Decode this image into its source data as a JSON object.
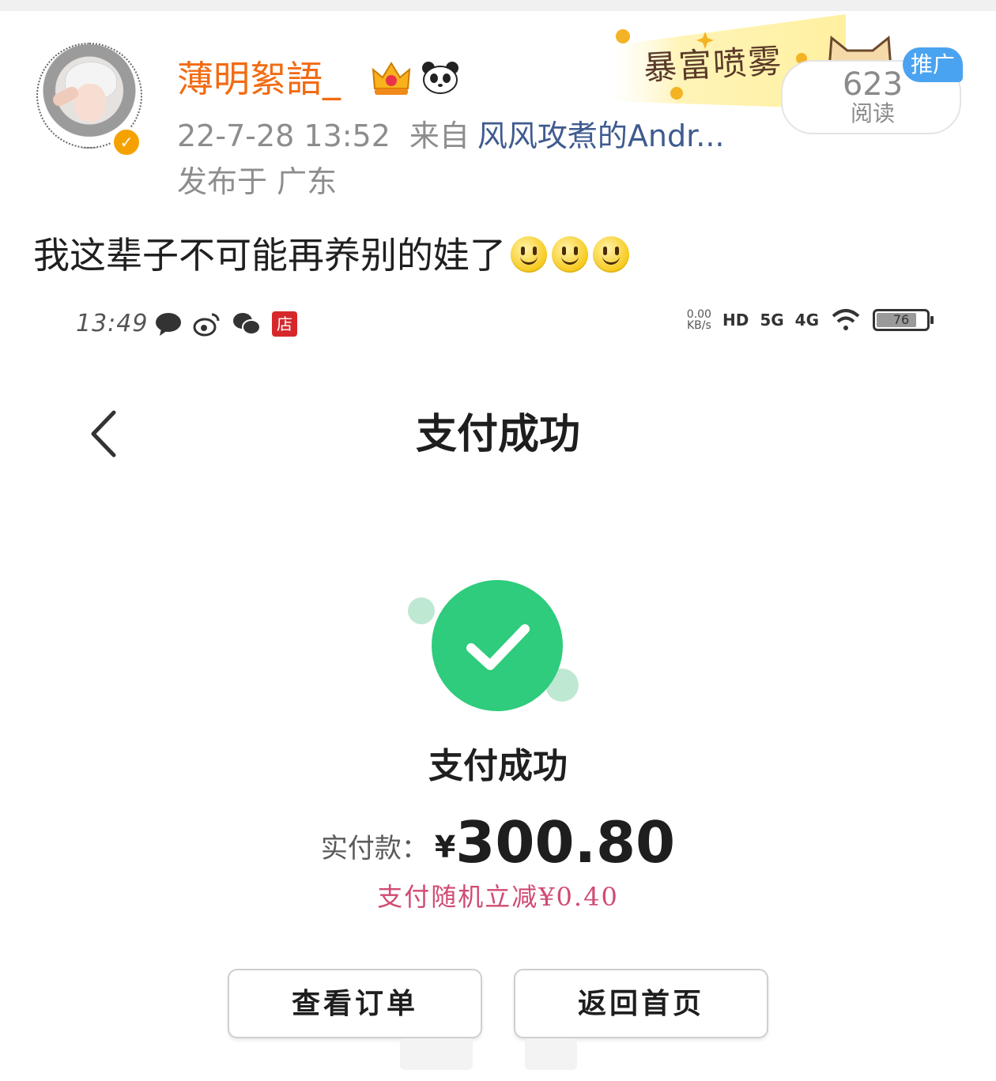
{
  "post": {
    "username": "薄明絮語_",
    "time": "22-7-28 13:52",
    "source_prefix": "来自",
    "client": "风风攻煮的Andr...",
    "location": "发布于 广东",
    "text": "我这辈子不可能再养别的娃了",
    "emoji_count": 3,
    "icons": [
      "crown-badge-icon",
      "panda-icon",
      "verified-badge-icon"
    ]
  },
  "ad": {
    "banner_text": "暴富喷雾",
    "promo_label": "推广",
    "read_count": "623",
    "read_label": "阅读"
  },
  "screenshot": {
    "status_bar": {
      "time": "13:49",
      "shop_icon_label": "店",
      "speed_value": "0.00",
      "speed_unit": "KB/s",
      "hd_label": "HD",
      "net1": "5G",
      "net2": "4G",
      "battery": "76",
      "icons": [
        "chat-bubble-icon",
        "weibo-icon",
        "wechat-icon",
        "shop-icon",
        "wifi-icon",
        "battery-icon"
      ]
    },
    "title": "支付成功",
    "success_label": "支付成功",
    "paid_label": "实付款：",
    "currency": "¥",
    "amount": "300.80",
    "discount": "支付随机立减¥0.40",
    "buttons": {
      "view_orders": "查看订单",
      "back_home": "返回首页"
    },
    "colors": {
      "success_green": "#2ecc7c",
      "discount_pink": "#d04b72",
      "username_orange": "#f26b13",
      "client_link_blue": "#3f5b8f",
      "promo_blue": "#4aa3f0"
    }
  }
}
